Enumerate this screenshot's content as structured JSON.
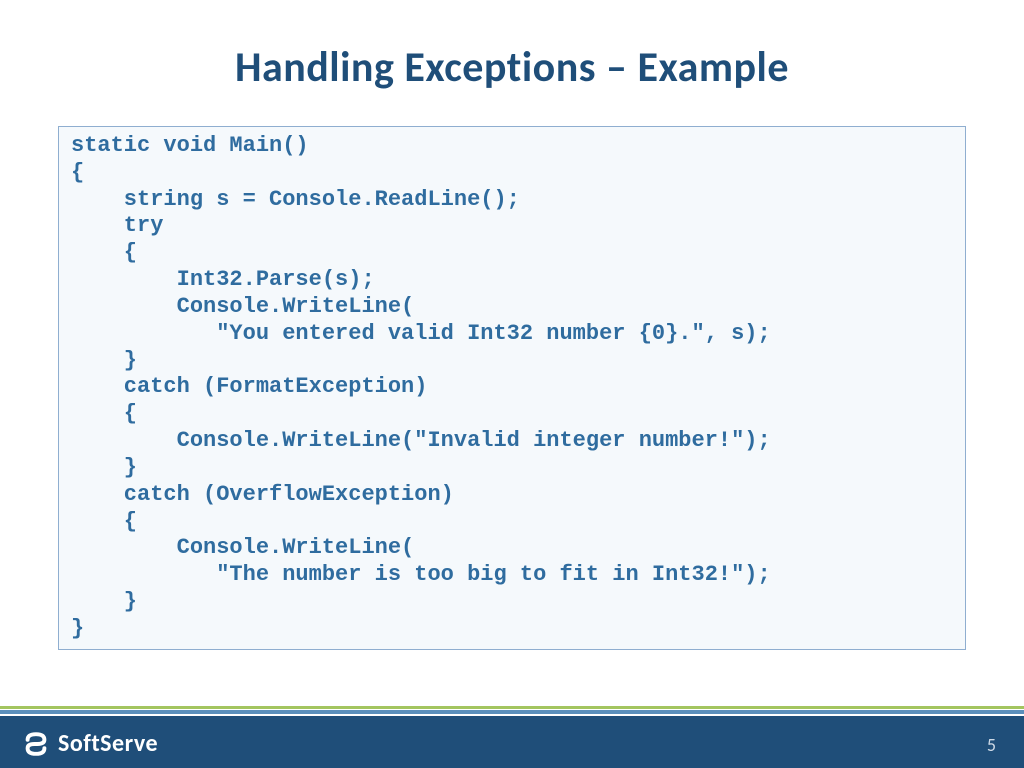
{
  "title": "Handling Exceptions – Example",
  "code": "static void Main()\n{\n    string s = Console.ReadLine();\n    try\n    {\n        Int32.Parse(s);\n        Console.WriteLine(\n           \"You entered valid Int32 number {0}.\", s);\n    }\n    catch (FormatException)\n    {\n        Console.WriteLine(\"Invalid integer number!\");\n    }\n    catch (OverflowException)\n    {\n        Console.WriteLine(\n           \"The number is too big to fit in Int32!\");\n    }\n}",
  "brand": "SoftServe",
  "pageNumber": "5"
}
